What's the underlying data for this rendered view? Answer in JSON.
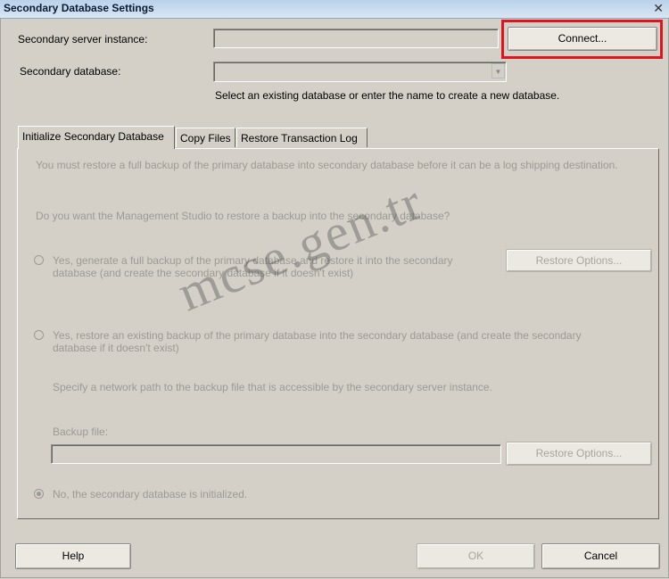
{
  "window": {
    "title": "Secondary Database Settings",
    "close_glyph": "✕"
  },
  "server": {
    "label": "Secondary server instance:",
    "value": "",
    "connect_label": "Connect..."
  },
  "database": {
    "label": "Secondary database:",
    "value": "",
    "hint": "Select an existing database or enter the name to create a new database."
  },
  "tabs": [
    {
      "label": "Initialize Secondary Database",
      "active": true
    },
    {
      "label": "Copy Files",
      "active": false
    },
    {
      "label": "Restore Transaction Log",
      "active": false
    }
  ],
  "panel": {
    "intro": "You must restore a full backup of the primary database into secondary database before it can be a log shipping destination.",
    "question": "Do you want the Management Studio to restore a backup into the secondary database?",
    "option1": {
      "line1": "Yes, generate a full backup of the primary database and restore it into the secondary",
      "line2": "database (and create the secondary database if it doesn't exist)",
      "button": "Restore Options...",
      "selected": false
    },
    "option2": {
      "line1": "Yes, restore an existing backup of the primary database into the secondary database (and create the secondary",
      "line2": "database if it doesn't exist)",
      "network_hint": "Specify a network path to the backup file that is accessible by the secondary server instance.",
      "backup_label": "Backup file:",
      "backup_value": "",
      "button": "Restore Options...",
      "selected": false
    },
    "option3": {
      "label": "No, the secondary database is initialized.",
      "selected": true
    }
  },
  "footer": {
    "help": "Help",
    "ok": "OK",
    "cancel": "Cancel"
  },
  "watermark": "mcse.gen.tr",
  "colors": {
    "highlight_box": "#e0141c",
    "dialog_bg": "#d4d0c8",
    "disabled_text": "#9c9a94"
  }
}
